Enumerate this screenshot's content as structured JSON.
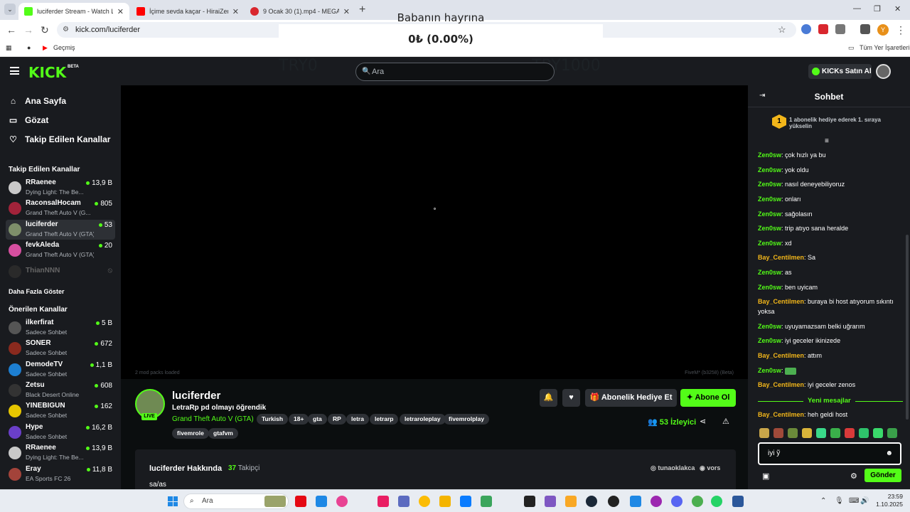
{
  "browser": {
    "tabs": [
      {
        "title": "luciferder Stream - Watch L",
        "active": true,
        "color": "#53fc18"
      },
      {
        "title": "İçime sevda kaçar - HiraiZerdüş",
        "active": false,
        "color": "#ff0000"
      },
      {
        "title": "9 Ocak 30 (1).mp4 - MEGA",
        "active": false,
        "color": "#d9272e"
      }
    ],
    "url": "kick.com/luciferder",
    "bookmark_item": "Geçmiş",
    "bookmarks_folder": "Tüm Yer İşaretleri",
    "profile_initial": "Y"
  },
  "overlay": {
    "title": "Babanın hayrına",
    "amount": "0₺ (0.00%)",
    "min": "TRY0",
    "max": "TRY1000"
  },
  "header": {
    "logo": "KICK",
    "logo_badge": "BETA",
    "search_placeholder": "Ara",
    "buy_label": "KICKs Satın Al"
  },
  "sidebar": {
    "nav": [
      {
        "label": "Ana Sayfa",
        "icon": "home-icon"
      },
      {
        "label": "Gözat",
        "icon": "browse-icon"
      },
      {
        "label": "Takip Edilen Kanallar",
        "icon": "heart-icon"
      }
    ],
    "followed_title": "Takip Edilen Kanallar",
    "followed": [
      {
        "name": "RRaenee",
        "game": "Dying Light: The Be...",
        "viewers": "13,9 B",
        "live": true,
        "color": "#c9c9c9"
      },
      {
        "name": "RaconsalHocam",
        "game": "Grand Theft Auto V (G...",
        "viewers": "805",
        "live": true,
        "color": "#a2233a"
      },
      {
        "name": "luciferder",
        "game": "Grand Theft Auto V (GTA)",
        "viewers": "53",
        "live": true,
        "color": "#7e8f6a"
      },
      {
        "name": "fevkAleda",
        "game": "Grand Theft Auto V (GTA)",
        "viewers": "20",
        "live": true,
        "color": "#d64fa0"
      },
      {
        "name": "ThianNNN",
        "game": "",
        "viewers": "",
        "live": false,
        "color": "#2a2a2a"
      }
    ],
    "show_more": "Daha Fazla Göster",
    "recommended_title": "Önerilen Kanallar",
    "recommended": [
      {
        "name": "ilkerfirat",
        "game": "Sadece Sohbet",
        "viewers": "5 B",
        "color": "#555"
      },
      {
        "name": "SONER",
        "game": "Sadece Sohbet",
        "viewers": "672",
        "color": "#8a2a1e"
      },
      {
        "name": "DemodeTV",
        "game": "Sadece Sohbet",
        "viewers": "1,1 B",
        "color": "#1d7fd1"
      },
      {
        "name": "Zetsu",
        "game": "Black Desert Online",
        "viewers": "608",
        "color": "#333"
      },
      {
        "name": "YINEBIGUN",
        "game": "Sadece Sohbet",
        "viewers": "162",
        "color": "#e6c600"
      },
      {
        "name": "Hype",
        "game": "Sadece Sohbet",
        "viewers": "16,2 B",
        "color": "#6a3fc9"
      },
      {
        "name": "RRaenee",
        "game": "Dying Light: The Be...",
        "viewers": "13,9 B",
        "color": "#c9c9c9"
      },
      {
        "name": "Eray",
        "game": "EA Sports FC 26",
        "viewers": "11,8 B",
        "color": "#a3433a"
      }
    ]
  },
  "player": {
    "left_note": "2 mod packs loaded",
    "right_note": "FiveM* (b3258) (Beta)"
  },
  "channel": {
    "name": "luciferder",
    "live_badge": "LIVE",
    "title": "LetraRp pd olmayı öğrendik",
    "category": "Grand Theft Auto V (GTA)",
    "tags": [
      "Turkish",
      "18+",
      "gta",
      "RP",
      "letra",
      "letrarp",
      "letraroleplay",
      "fivemrolplay",
      "fivemrole",
      "gtafvm"
    ],
    "gift_label": "Abonelik Hediye Et",
    "subscribe_label": "Abone Ol",
    "viewers_count": "53",
    "viewers_label": "İzleyici",
    "about_title": "luciferder Hakkında",
    "followers_count": "37",
    "followers_label": "Takipçi",
    "about_text": "sa/as",
    "social": [
      "tunaoklakca",
      "vors"
    ]
  },
  "chat": {
    "title": "Sohbet",
    "gift_rank": "1",
    "gift_text": "1 abonelik hediye ederek 1. sıraya yükselin",
    "messages": [
      {
        "user": "Zen0sw",
        "text": "çok hızlı ya bu",
        "color": "#53fc18"
      },
      {
        "user": "Zen0sw",
        "text": "yok oldu",
        "color": "#53fc18"
      },
      {
        "user": "Zen0sw",
        "text": "nasıl deneyebiliyoruz",
        "color": "#53fc18"
      },
      {
        "user": "Zen0sw",
        "text": "onları",
        "color": "#53fc18"
      },
      {
        "user": "Zen0sw",
        "text": "sağolasın",
        "color": "#53fc18"
      },
      {
        "user": "Zen0sw",
        "text": "trip atıyo sana heralde",
        "color": "#53fc18"
      },
      {
        "user": "Zen0sw",
        "text": "xd",
        "color": "#53fc18"
      },
      {
        "user": "Bay_Centilmen",
        "text": "Sa",
        "color": "#f2b61a"
      },
      {
        "user": "Zen0sw",
        "text": "as",
        "color": "#53fc18"
      },
      {
        "user": "Zen0sw",
        "text": "ben uyicam",
        "color": "#53fc18"
      },
      {
        "user": "Bay_Centilmen",
        "text": "buraya bi host atıyorum sıkıntı yoksa",
        "color": "#f2b61a"
      },
      {
        "user": "Zen0sw",
        "text": "uyuyamazsam belki uğrarım",
        "color": "#53fc18"
      },
      {
        "user": "Zen0sw",
        "text": "iyi geceler ikinizede",
        "color": "#53fc18"
      },
      {
        "user": "Bay_Centilmen",
        "text": "attım",
        "color": "#f2b61a"
      },
      {
        "user": "Zen0sw",
        "text": "",
        "color": "#53fc18"
      },
      {
        "user": "Bay_Centilmen",
        "text": "iyi geceler zenos",
        "color": "#f2b61a"
      }
    ],
    "new_messages_label": "Yeni mesajlar",
    "after_new": [
      {
        "user": "Bay_Centilmen",
        "text": "heh geldi host",
        "color": "#f2b61a"
      }
    ],
    "input_value": "iyi ỹ",
    "send_label": "Gönder"
  },
  "taskbar": {
    "search_placeholder": "Ara",
    "time": "23:59",
    "date": "1.10.2025"
  }
}
